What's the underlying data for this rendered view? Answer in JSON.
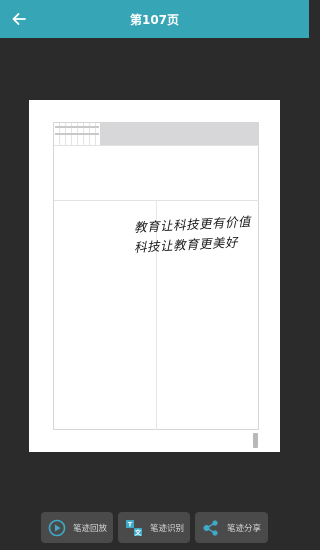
{
  "header": {
    "title": "第107页"
  },
  "note": {
    "line1": "教育让科技更有价值",
    "line2": "科技让教育更美好"
  },
  "toolbar": {
    "replay_label": "笔迹回放",
    "recognize_label": "笔迹识别",
    "share_label": "笔迹分享"
  },
  "colors": {
    "header_bg": "#36a6b7",
    "app_bg": "#2b2b2b",
    "button_bg": "#4a4a4a",
    "accent": "#3fa9c8"
  },
  "icons": {
    "back": "arrow-left-icon",
    "replay": "play-circle-icon",
    "recognize": "text-recognition-icon",
    "share": "share-icon"
  }
}
